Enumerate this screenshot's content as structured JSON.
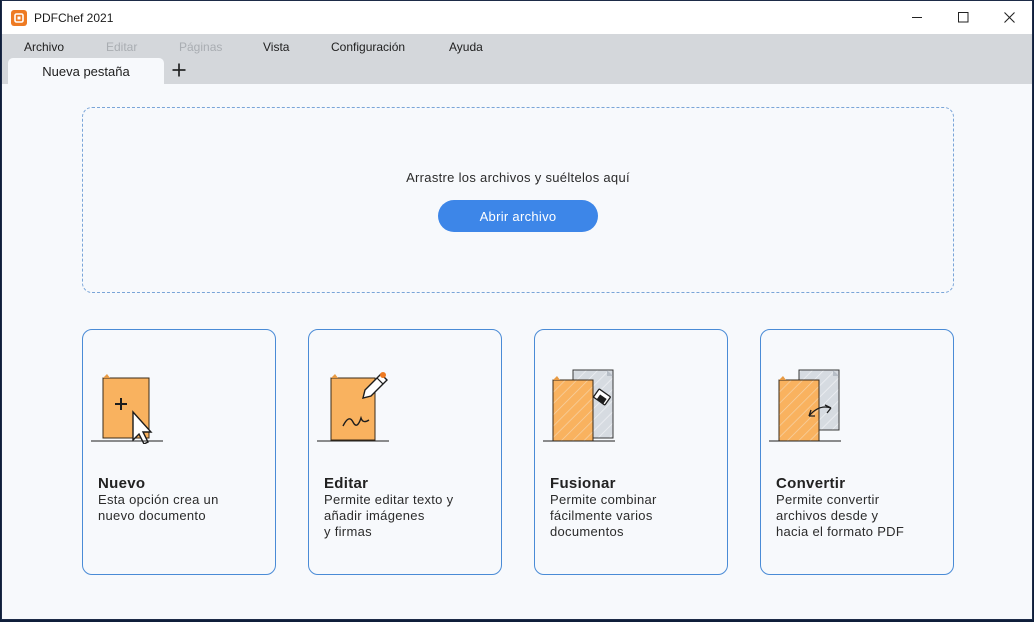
{
  "window": {
    "title": "PDFChef 2021",
    "controls": {
      "minimize": "–",
      "maximize": "☐",
      "close": "✕"
    }
  },
  "menu": {
    "items": [
      {
        "label": "Archivo",
        "enabled": true
      },
      {
        "label": "Editar",
        "enabled": false
      },
      {
        "label": "Páginas",
        "enabled": false
      },
      {
        "label": "Vista",
        "enabled": true
      },
      {
        "label": "Configuración",
        "enabled": true
      },
      {
        "label": "Ayuda",
        "enabled": true
      }
    ]
  },
  "tabs": {
    "active": "Nueva pestaña",
    "add_icon": "plus-icon"
  },
  "dropzone": {
    "text": "Arrastre los archivos y suéltelos aquí",
    "button": "Abrir archivo"
  },
  "cards": [
    {
      "title": "Nuevo",
      "description": "Esta opción crea un\nnuevo documento",
      "icon": "new-document-icon"
    },
    {
      "title": "Editar",
      "description": "Permite editar texto y\nañadir imágenes\ny firmas",
      "icon": "edit-document-icon"
    },
    {
      "title": "Fusionar",
      "description": "Permite combinar\nfácilmente varios\ndocumentos",
      "icon": "merge-documents-icon"
    },
    {
      "title": "Convertir",
      "description": "Permite convertir\narchivos desde y\nhacia el formato PDF",
      "icon": "convert-document-icon"
    }
  ],
  "colors": {
    "accent": "#3d86e8",
    "card_border": "#4a8bd6",
    "doc_orange": "#f9b25f",
    "doc_gray": "#d6dbe1",
    "logo": "#ee7a22"
  }
}
